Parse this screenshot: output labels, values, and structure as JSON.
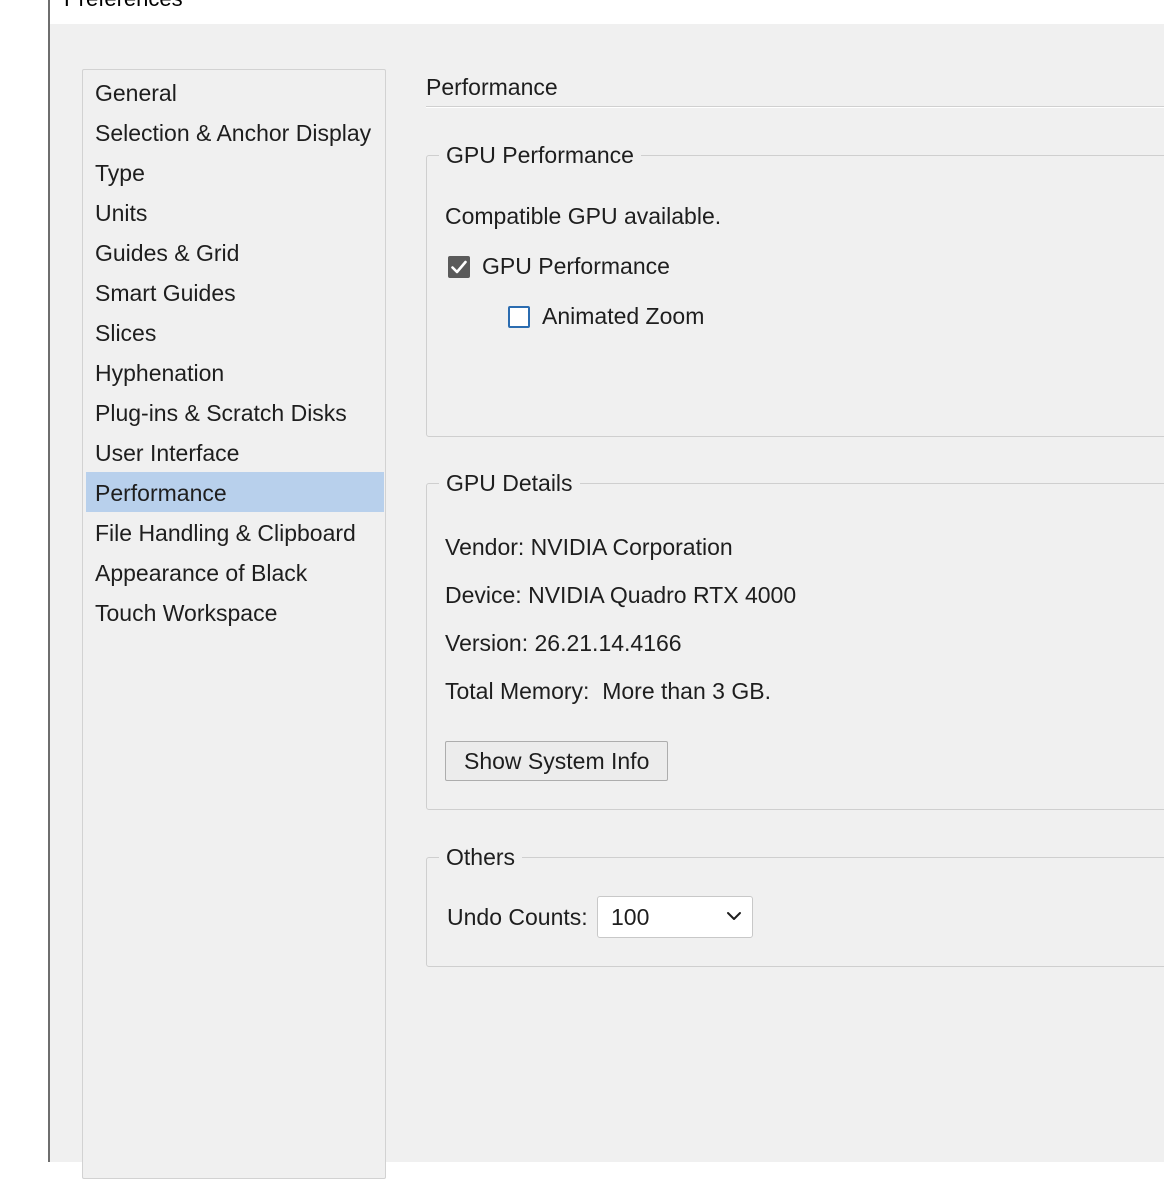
{
  "window": {
    "title": "Preferences"
  },
  "sidebar": {
    "items": [
      {
        "label": "General"
      },
      {
        "label": "Selection & Anchor Display"
      },
      {
        "label": "Type"
      },
      {
        "label": "Units"
      },
      {
        "label": "Guides & Grid"
      },
      {
        "label": "Smart Guides"
      },
      {
        "label": "Slices"
      },
      {
        "label": "Hyphenation"
      },
      {
        "label": "Plug-ins & Scratch Disks"
      },
      {
        "label": "User Interface"
      },
      {
        "label": "Performance",
        "selected": true
      },
      {
        "label": "File Handling & Clipboard"
      },
      {
        "label": "Appearance of Black"
      },
      {
        "label": "Touch Workspace"
      }
    ]
  },
  "main": {
    "title": "Performance",
    "gpu_performance": {
      "legend": "GPU Performance",
      "status": "Compatible GPU available.",
      "gpu_checkbox": {
        "label": "GPU Performance",
        "checked": true
      },
      "zoom_checkbox": {
        "label": "Animated Zoom",
        "checked": false
      }
    },
    "gpu_details": {
      "legend": "GPU Details",
      "vendor": "Vendor: NVIDIA Corporation",
      "device": "Device: NVIDIA Quadro RTX 4000",
      "version": "Version: 26.21.14.4166",
      "memory": "Total Memory:  More than 3 GB.",
      "button_label": "Show System Info"
    },
    "others": {
      "legend": "Others",
      "undo_label": "Undo Counts:",
      "undo_value": "100"
    }
  },
  "colors": {
    "selection": "#b8d0ec",
    "panel_bg": "#f0f0f0",
    "checkbox_checked": "#5a5a5a",
    "checkbox_unchecked_border": "#2b6cb0"
  },
  "icons": [
    "checkmark-icon",
    "chevron-down-icon"
  ]
}
